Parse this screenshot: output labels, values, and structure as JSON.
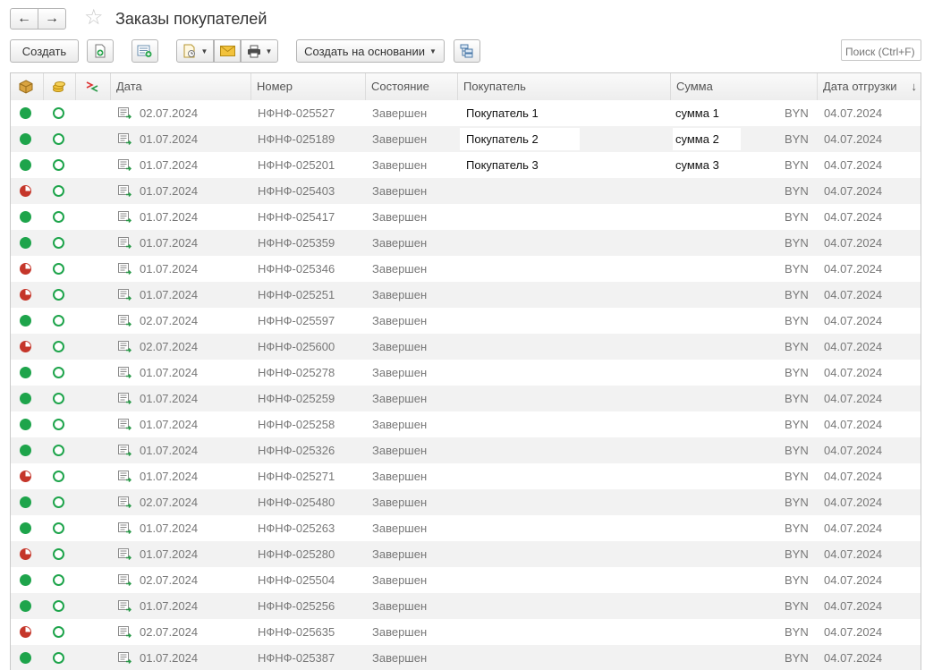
{
  "window": {
    "title": "Заказы покупателей",
    "back_icon": "arrow-left-icon",
    "forward_icon": "arrow-right-icon",
    "favorite_icon": "star-icon"
  },
  "toolbar": {
    "create_label": "Создать",
    "create_basis_label": "Создать на основании",
    "search_placeholder": "Поиск (Ctrl+F)",
    "icons": [
      "copy-document-icon",
      "add-to-list-icon",
      "document-history-icon",
      "email-icon",
      "print-icon",
      "structure-icon"
    ]
  },
  "columns": {
    "status_icon": "box-icon",
    "payment_icon": "coins-icon",
    "compare_icon": "diff-arrows-icon",
    "date": "Дата",
    "number": "Номер",
    "state": "Состояние",
    "customer": "Покупатель",
    "sum": "Сумма",
    "ship_date": "Дата отгрузки",
    "sort_indicator": "↓"
  },
  "colors": {
    "status_green": "#1ea44b",
    "status_partial": "#c5362a",
    "row_alt": "#f2f2f2"
  },
  "rows": [
    {
      "shipment": "full",
      "date": "02.07.2024",
      "number": "НФНФ-025527",
      "state": "Завершен",
      "customer": "Покупатель 1",
      "sum": "сумма 1",
      "currency": "BYN",
      "ship_date": "04.07.2024"
    },
    {
      "shipment": "full",
      "date": "01.07.2024",
      "number": "НФНФ-025189",
      "state": "Завершен",
      "customer": "Покупатель 2",
      "sum": "сумма 2",
      "currency": "BYN",
      "ship_date": "04.07.2024"
    },
    {
      "shipment": "full",
      "date": "01.07.2024",
      "number": "НФНФ-025201",
      "state": "Завершен",
      "customer": "Покупатель 3",
      "sum": "сумма 3",
      "currency": "BYN",
      "ship_date": "04.07.2024"
    },
    {
      "shipment": "partial",
      "date": "01.07.2024",
      "number": "НФНФ-025403",
      "state": "Завершен",
      "customer": "",
      "sum": "",
      "currency": "BYN",
      "ship_date": "04.07.2024"
    },
    {
      "shipment": "full",
      "date": "01.07.2024",
      "number": "НФНФ-025417",
      "state": "Завершен",
      "customer": "",
      "sum": "",
      "currency": "BYN",
      "ship_date": "04.07.2024"
    },
    {
      "shipment": "full",
      "date": "01.07.2024",
      "number": "НФНФ-025359",
      "state": "Завершен",
      "customer": "",
      "sum": "",
      "currency": "BYN",
      "ship_date": "04.07.2024"
    },
    {
      "shipment": "partial",
      "date": "01.07.2024",
      "number": "НФНФ-025346",
      "state": "Завершен",
      "customer": "",
      "sum": "",
      "currency": "BYN",
      "ship_date": "04.07.2024"
    },
    {
      "shipment": "partial",
      "date": "01.07.2024",
      "number": "НФНФ-025251",
      "state": "Завершен",
      "customer": "",
      "sum": "",
      "currency": "BYN",
      "ship_date": "04.07.2024"
    },
    {
      "shipment": "full",
      "date": "02.07.2024",
      "number": "НФНФ-025597",
      "state": "Завершен",
      "customer": "",
      "sum": "",
      "currency": "BYN",
      "ship_date": "04.07.2024"
    },
    {
      "shipment": "partial",
      "date": "02.07.2024",
      "number": "НФНФ-025600",
      "state": "Завершен",
      "customer": "",
      "sum": "",
      "currency": "BYN",
      "ship_date": "04.07.2024"
    },
    {
      "shipment": "full",
      "date": "01.07.2024",
      "number": "НФНФ-025278",
      "state": "Завершен",
      "customer": "",
      "sum": "",
      "currency": "BYN",
      "ship_date": "04.07.2024"
    },
    {
      "shipment": "full",
      "date": "01.07.2024",
      "number": "НФНФ-025259",
      "state": "Завершен",
      "customer": "",
      "sum": "",
      "currency": "BYN",
      "ship_date": "04.07.2024"
    },
    {
      "shipment": "full",
      "date": "01.07.2024",
      "number": "НФНФ-025258",
      "state": "Завершен",
      "customer": "",
      "sum": "",
      "currency": "BYN",
      "ship_date": "04.07.2024"
    },
    {
      "shipment": "full",
      "date": "01.07.2024",
      "number": "НФНФ-025326",
      "state": "Завершен",
      "customer": "",
      "sum": "",
      "currency": "BYN",
      "ship_date": "04.07.2024"
    },
    {
      "shipment": "partial",
      "date": "01.07.2024",
      "number": "НФНФ-025271",
      "state": "Завершен",
      "customer": "",
      "sum": "",
      "currency": "BYN",
      "ship_date": "04.07.2024"
    },
    {
      "shipment": "full",
      "date": "02.07.2024",
      "number": "НФНФ-025480",
      "state": "Завершен",
      "customer": "",
      "sum": "",
      "currency": "BYN",
      "ship_date": "04.07.2024"
    },
    {
      "shipment": "full",
      "date": "01.07.2024",
      "number": "НФНФ-025263",
      "state": "Завершен",
      "customer": "",
      "sum": "",
      "currency": "BYN",
      "ship_date": "04.07.2024"
    },
    {
      "shipment": "partial",
      "date": "01.07.2024",
      "number": "НФНФ-025280",
      "state": "Завершен",
      "customer": "",
      "sum": "",
      "currency": "BYN",
      "ship_date": "04.07.2024"
    },
    {
      "shipment": "full",
      "date": "02.07.2024",
      "number": "НФНФ-025504",
      "state": "Завершен",
      "customer": "",
      "sum": "",
      "currency": "BYN",
      "ship_date": "04.07.2024"
    },
    {
      "shipment": "full",
      "date": "01.07.2024",
      "number": "НФНФ-025256",
      "state": "Завершен",
      "customer": "",
      "sum": "",
      "currency": "BYN",
      "ship_date": "04.07.2024"
    },
    {
      "shipment": "partial",
      "date": "02.07.2024",
      "number": "НФНФ-025635",
      "state": "Завершен",
      "customer": "",
      "sum": "",
      "currency": "BYN",
      "ship_date": "04.07.2024"
    },
    {
      "shipment": "full",
      "date": "01.07.2024",
      "number": "НФНФ-025387",
      "state": "Завершен",
      "customer": "",
      "sum": "",
      "currency": "BYN",
      "ship_date": "04.07.2024"
    }
  ]
}
